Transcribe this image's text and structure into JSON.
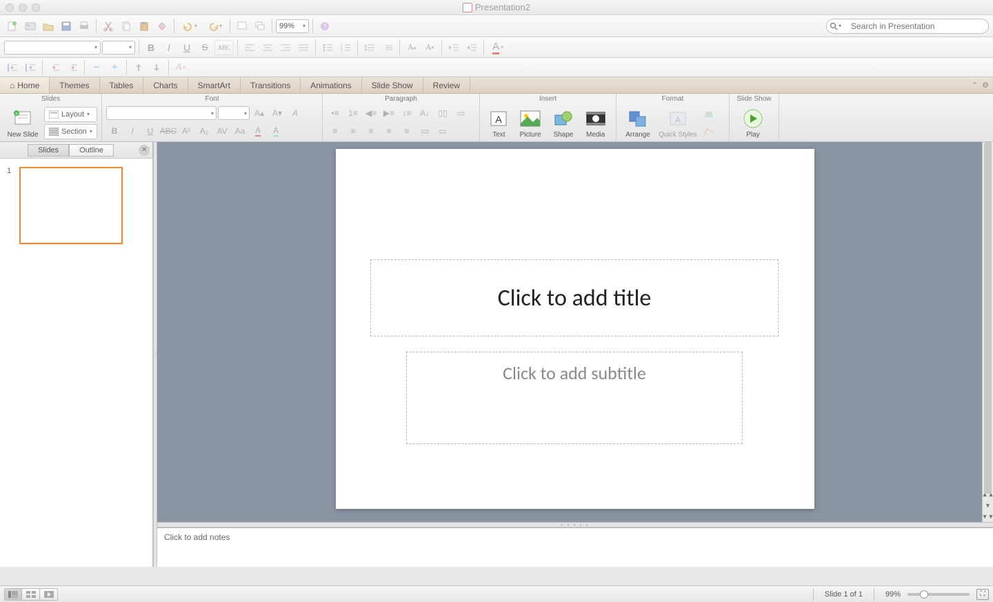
{
  "window": {
    "title": "Presentation2"
  },
  "toolbar1": {
    "zoom": "99%"
  },
  "search": {
    "placeholder": "Search in Presentation"
  },
  "tabs": [
    "Home",
    "Themes",
    "Tables",
    "Charts",
    "SmartArt",
    "Transitions",
    "Animations",
    "Slide Show",
    "Review"
  ],
  "ribbon": {
    "groups": {
      "slides": {
        "title": "Slides",
        "new_slide": "New Slide",
        "layout": "Layout",
        "section": "Section"
      },
      "font": {
        "title": "Font"
      },
      "paragraph": {
        "title": "Paragraph"
      },
      "insert": {
        "title": "Insert",
        "text": "Text",
        "picture": "Picture",
        "shape": "Shape",
        "media": "Media"
      },
      "format": {
        "title": "Format",
        "arrange": "Arrange",
        "quick_styles": "Quick Styles"
      },
      "slideshow": {
        "title": "Slide Show",
        "play": "Play"
      }
    }
  },
  "sidepanel": {
    "tabs": [
      "Slides",
      "Outline"
    ],
    "slide_number": "1"
  },
  "slide": {
    "title_placeholder": "Click to add title",
    "subtitle_placeholder": "Click to add subtitle"
  },
  "notes": {
    "placeholder": "Click to add notes"
  },
  "status": {
    "slide_info": "Slide 1 of 1",
    "zoom": "99%"
  }
}
